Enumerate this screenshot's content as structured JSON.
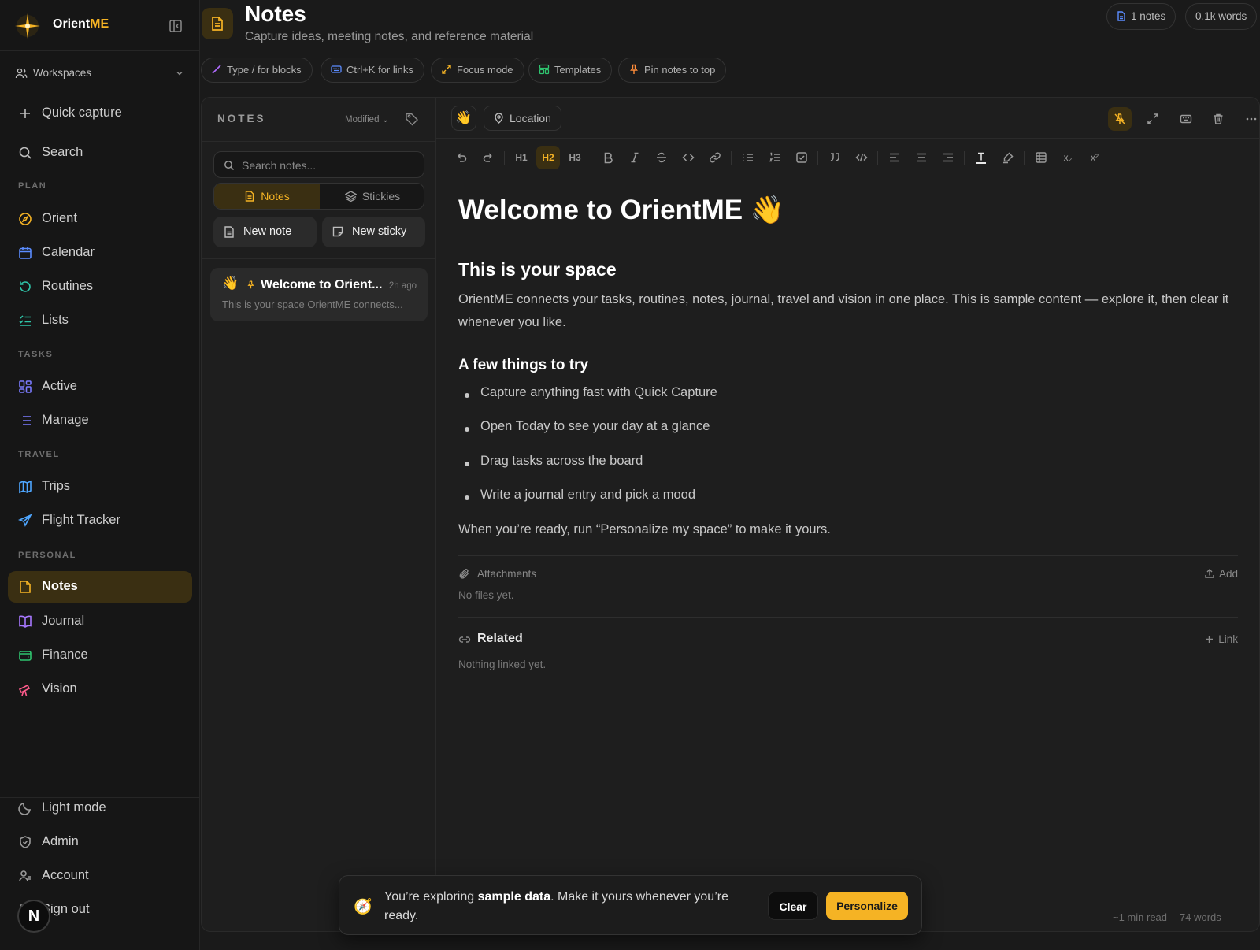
{
  "brand": {
    "name_prefix": "Orient",
    "name_accent": "ME"
  },
  "workspace": {
    "label": "Workspaces"
  },
  "sidebar": {
    "top_items": [
      {
        "label": "Quick capture",
        "icon": "plus-icon"
      },
      {
        "label": "Search",
        "icon": "search-icon"
      }
    ],
    "sections": [
      {
        "label": "PLAN",
        "items": [
          {
            "label": "Orient",
            "icon": "compass-icon"
          },
          {
            "label": "Calendar",
            "icon": "calendar-icon"
          },
          {
            "label": "Routines",
            "icon": "refresh-icon"
          },
          {
            "label": "Lists",
            "icon": "checklist-icon"
          }
        ]
      },
      {
        "label": "TASKS",
        "items": [
          {
            "label": "Active",
            "icon": "grid-icon"
          },
          {
            "label": "Manage",
            "icon": "list-icon"
          }
        ]
      },
      {
        "label": "TRAVEL",
        "items": [
          {
            "label": "Trips",
            "icon": "map-icon"
          },
          {
            "label": "Flight Tracker",
            "icon": "plane-icon"
          }
        ]
      },
      {
        "label": "PERSONAL",
        "items": [
          {
            "label": "Notes",
            "icon": "note-icon",
            "active": true
          },
          {
            "label": "Journal",
            "icon": "book-icon"
          },
          {
            "label": "Finance",
            "icon": "wallet-icon"
          },
          {
            "label": "Vision",
            "icon": "telescope-icon"
          }
        ]
      }
    ],
    "footer": [
      {
        "label": "Light mode",
        "icon": "moon-icon"
      },
      {
        "label": "Admin",
        "icon": "shield-icon"
      },
      {
        "label": "Account",
        "icon": "user-icon"
      },
      {
        "label": "Sign out",
        "icon": "logout-icon"
      }
    ],
    "badge": "N"
  },
  "header": {
    "title": "Notes",
    "subtitle": "Capture ideas, meeting notes, and reference material",
    "stats": {
      "notes": "1 notes",
      "words": "0.1k words"
    },
    "tips": [
      "Type / for blocks",
      "Ctrl+K for links",
      "Focus mode",
      "Templates",
      "Pin notes to top"
    ]
  },
  "list": {
    "title": "NOTES",
    "sort": "Modified",
    "search_placeholder": "Search notes...",
    "tabs": [
      "Notes",
      "Stickies"
    ],
    "new_note": "New note",
    "new_sticky": "New sticky",
    "notes": [
      {
        "emoji": "👋",
        "title": "Welcome to Orient...",
        "ago": "2h ago",
        "snippet": "This is your space OrientME connects..."
      }
    ]
  },
  "editor": {
    "emoji": "👋",
    "location": "Location",
    "toolbar": {
      "h1": "H1",
      "h2": "H2",
      "h3": "H3",
      "sub": "x₂",
      "sup": "x²"
    },
    "doc": {
      "h1": "Welcome to OrientME 👋",
      "h2": "This is your space",
      "intro": "OrientME connects your tasks, routines, notes, journal, travel and vision in one place. This is sample content — explore it, then clear it whenever you like.",
      "h3": "A few things to try",
      "bullets": [
        "Capture anything fast with Quick Capture",
        "Open Today to see your day at a glance",
        "Drag tasks across the board",
        "Write a journal entry and pick a mood"
      ],
      "outro": "When you’re ready, run “Personalize my space” to make it yours."
    },
    "attachments": {
      "label": "Attachments",
      "action": "Add",
      "empty": "No files yet."
    },
    "related": {
      "label": "Related",
      "action": "Link",
      "empty": "Nothing linked yet."
    },
    "footer": {
      "read": "~1 min read",
      "words": "74 words"
    }
  },
  "toast": {
    "icon": "🧭",
    "message_prefix": "You’re exploring ",
    "message_bold": "sample data",
    "message_suffix": ". Make it yours whenever you’re ready.",
    "clear": "Clear",
    "personalize": "Personalize"
  },
  "colors": {
    "accent": "#f5b324",
    "active_bg": "#3a2f12",
    "bg": "#1a1a1a",
    "sidebar_bg": "#161616"
  }
}
